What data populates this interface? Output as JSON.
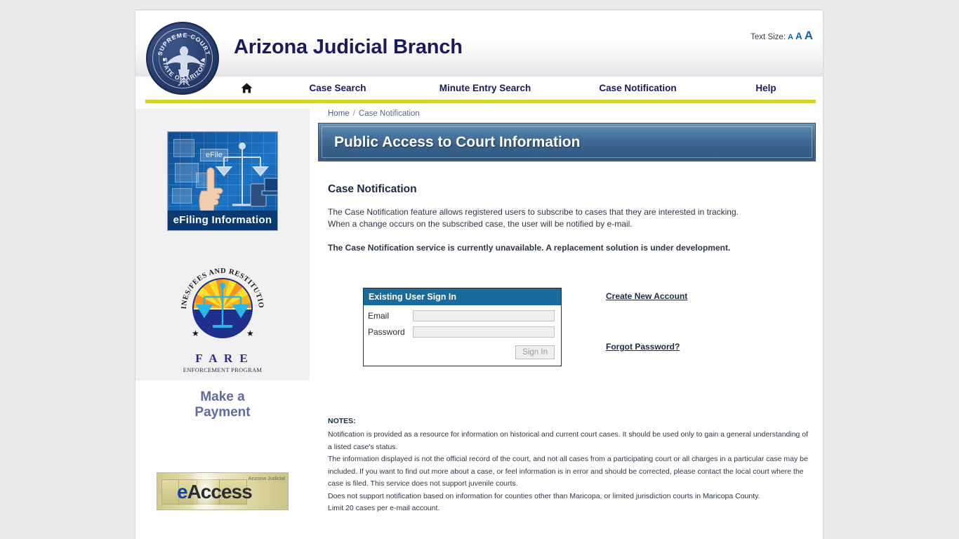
{
  "header": {
    "brand_title": "Arizona Judicial Branch",
    "seal": {
      "top_text": "SUPREME COURT",
      "bottom_text": "STATE OF ARIZONA"
    },
    "text_size": {
      "label": "Text Size:",
      "small": "A",
      "medium": "A",
      "large": "A",
      "color": "#1560b0"
    }
  },
  "nav": {
    "home_icon": "home-icon",
    "items": [
      {
        "label": "Case Search"
      },
      {
        "label": "Minute Entry Search"
      },
      {
        "label": "Case Notification"
      },
      {
        "label": "Help"
      }
    ],
    "accent_color": "#d2d62b"
  },
  "breadcrumb": {
    "home": "Home",
    "separator": "/",
    "current": "Case Notification"
  },
  "banner": {
    "title": "Public Access to Court Information",
    "color": "#39618c"
  },
  "main": {
    "section_title": "Case Notification",
    "paragraph_1": "The Case Notification feature allows registered users to subscribe to cases that they are interested in tracking.",
    "paragraph_2": "When a change occurs on the subscribed case, the user will be notified by e-mail.",
    "notice": "The Case Notification service is currently unavailable. A replacement solution is under development."
  },
  "signin": {
    "header": "Existing User Sign In",
    "email_label": "Email",
    "email_value": "",
    "email_placeholder": "",
    "password_label": "Password",
    "password_value": "",
    "password_placeholder": "",
    "submit_label": "Sign In",
    "create_account_label": "Create New Account",
    "forgot_password_label": "Forgot Password?"
  },
  "notes": {
    "title": "NOTES:",
    "lines": [
      "Notification is provided as a resource for information on historical and current court cases. It should be used only to gain a general understanding of a listed case's status.",
      "The information displayed is not the official record of the court, and not all cases from a participating court or all charges in a particular case may be included. If you want to find out more about a case, or feel information is in error and should be corrected, please contact the local court where the case is filed. This service does not support juvenile courts.",
      "Does not support notification based on information for counties other than Maricopa, or limited jurisdiction courts in Maricopa County.",
      "Limit 20 cases per e-mail account."
    ]
  },
  "sidebar": {
    "efiling": {
      "badge_text": "eFile",
      "caption": "eFiling  Information"
    },
    "fare": {
      "ring_text": "FINES/FEES AND RESTITUTION",
      "name": "F A R E",
      "subtitle": "ENFORCEMENT PROGRAM",
      "make_payment_line1": "Make a",
      "make_payment_line2": "Payment"
    },
    "eaccess": {
      "e": "e",
      "rest": "Access",
      "corner_text": "Arizona Judicial"
    }
  }
}
